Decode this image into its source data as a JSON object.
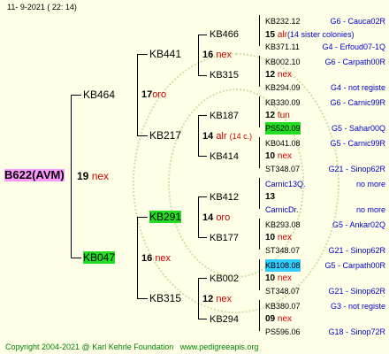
{
  "header": {
    "date": "11- 9-2021 ( 22: 14)"
  },
  "footer": {
    "copyright": "Copyright 2004-2021 @ Karl Kehrle Foundation",
    "url": "www.pedigreeapis.org"
  },
  "root": {
    "name": "B622(AVM)",
    "num": "19",
    "tag": "nex"
  },
  "gen1": [
    {
      "name": "KB464",
      "num": "17",
      "tag": "oro"
    },
    {
      "name": "KB047",
      "num": "16",
      "tag": "nex"
    }
  ],
  "gen2": [
    {
      "name": "KB441",
      "num": "16",
      "tag": "nex"
    },
    {
      "name": "KB217",
      "num": "14",
      "tag": "alr",
      "extra": "(14 c.)"
    },
    {
      "name": "KB291",
      "num": "14",
      "tag": "oro"
    },
    {
      "name": "KB315",
      "num": "12",
      "tag": "nex"
    }
  ],
  "gen3": [
    {
      "name": "KB466",
      "num": "15",
      "tag": "alr",
      "extra": "(14 sister colonies)"
    },
    {
      "name": "KB315",
      "num": "12",
      "tag": "nex"
    },
    {
      "name": "KB187",
      "num": "12",
      "tag": "tun"
    },
    {
      "name": "KB414",
      "num": "10",
      "tag": "nex"
    },
    {
      "name": "KB412",
      "num": "13",
      "tag": ""
    },
    {
      "name": "KB177",
      "num": "10",
      "tag": "nex"
    },
    {
      "name": "KB002",
      "num": "10",
      "tag": "nex"
    },
    {
      "name": "KB294",
      "num": "09",
      "tag": "nex"
    }
  ],
  "gen4": [
    {
      "name": "KB232.12",
      "note": "G6 - Cauca02R"
    },
    {
      "name": "KB371.11",
      "note": "G4 - Erfoud07-1Q"
    },
    {
      "name": "KB002.10",
      "note": "G6 - Carpath00R"
    },
    {
      "name": "KB294.09",
      "note": "G4 - not registe"
    },
    {
      "name": "KB330.09",
      "note": "G6 - Carnic99R"
    },
    {
      "name": "PS520.09",
      "note": "G5 - Sahar00Q"
    },
    {
      "name": "KB041.08",
      "note": "G5 - Carnic99R"
    },
    {
      "name": "ST348.07",
      "note": "G21 - Sinop62R"
    },
    {
      "name": "Carnic13Q.",
      "note": "no more"
    },
    {
      "name": "CarnicDr.",
      "note": "no more"
    },
    {
      "name": "KB293.08",
      "note": "G5 - Ankar02Q"
    },
    {
      "name": "ST348.07",
      "note": "G21 - Sinop62R"
    },
    {
      "name": "KB108.08",
      "note": "G5 - Carpath00R"
    },
    {
      "name": "ST348.07",
      "note": "G21 - Sinop62R"
    },
    {
      "name": "KB380.07",
      "note": "G3 - not registe"
    },
    {
      "name": "PS596.06",
      "note": "G18 - Sinop72R"
    }
  ]
}
